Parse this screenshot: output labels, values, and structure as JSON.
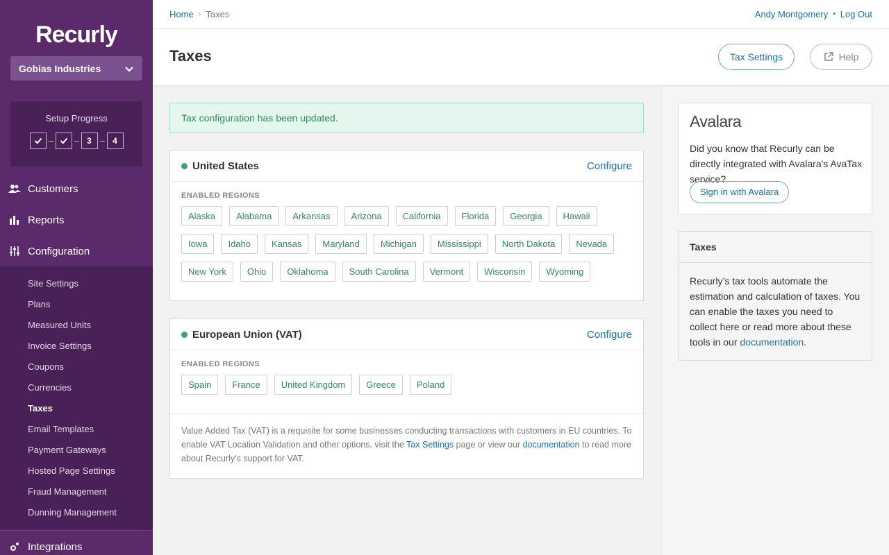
{
  "sidebar": {
    "logo": "Recurly",
    "account": "Gobias Industries",
    "setup": {
      "title": "Setup Progress",
      "steps": [
        {
          "label": "",
          "done": true
        },
        {
          "label": "",
          "done": true
        },
        {
          "label": "3",
          "done": false
        },
        {
          "label": "4",
          "done": false
        }
      ]
    },
    "nav": [
      {
        "label": "Customers",
        "icon": "customers-icon"
      },
      {
        "label": "Reports",
        "icon": "reports-icon"
      },
      {
        "label": "Configuration",
        "icon": "sliders-icon"
      },
      {
        "label": "Integrations",
        "icon": "integrations-icon"
      }
    ],
    "subnav": [
      "Site Settings",
      "Plans",
      "Measured Units",
      "Invoice Settings",
      "Coupons",
      "Currencies",
      "Taxes",
      "Email Templates",
      "Payment Gateways",
      "Hosted Page Settings",
      "Fraud Management",
      "Dunning Management"
    ],
    "active_subnav": "Taxes"
  },
  "header": {
    "breadcrumb": [
      "Home",
      "Taxes"
    ],
    "user": "Andy Montgomery",
    "logout": "Log Out",
    "title": "Taxes",
    "tax_settings": "Tax Settings",
    "help": "Help"
  },
  "alert": "Tax configuration has been updated.",
  "us": {
    "name": "United States",
    "configure": "Configure",
    "regions_label": "ENABLED REGIONS",
    "regions": [
      "Alaska",
      "Alabama",
      "Arkansas",
      "Arizona",
      "California",
      "Florida",
      "Georgia",
      "Hawaii",
      "Iowa",
      "Idaho",
      "Kansas",
      "Maryland",
      "Michigan",
      "Mississippi",
      "North Dakota",
      "Nevada",
      "New York",
      "Ohio",
      "Oklahoma",
      "South Carolina",
      "Vermont",
      "Wisconsin",
      "Wyoming"
    ]
  },
  "eu": {
    "name": "European Union (VAT)",
    "configure": "Configure",
    "regions_label": "ENABLED REGIONS",
    "regions": [
      "Spain",
      "France",
      "United Kingdom",
      "Greece",
      "Poland"
    ],
    "note_1": "Value Added Tax (VAT) is a requisite for some businesses conducting transactions with customers in EU countries. To enable VAT Location Validation and other options, visit the",
    "note_link_1": "Tax Settings",
    "note_2": "page or view our",
    "note_link_2": "documentation",
    "note_3": "to read more about Recurly's support for VAT."
  },
  "avalara": {
    "logo": "Avalara",
    "text": "Did you know that Recurly can be directly integrated with Avalara's AvaTax service?",
    "button": "Sign in with Avalara"
  },
  "taxes_info": {
    "title": "Taxes",
    "text": "Recurly’s tax tools automate the estimation and calculation of taxes. You can enable the taxes you need to collect here or read more about these tools in our",
    "link": "documentation",
    "end": "."
  },
  "colors": {
    "sidebar": "#5a2a6b",
    "link": "#1f6fa6",
    "success": "#2f8a5e"
  }
}
